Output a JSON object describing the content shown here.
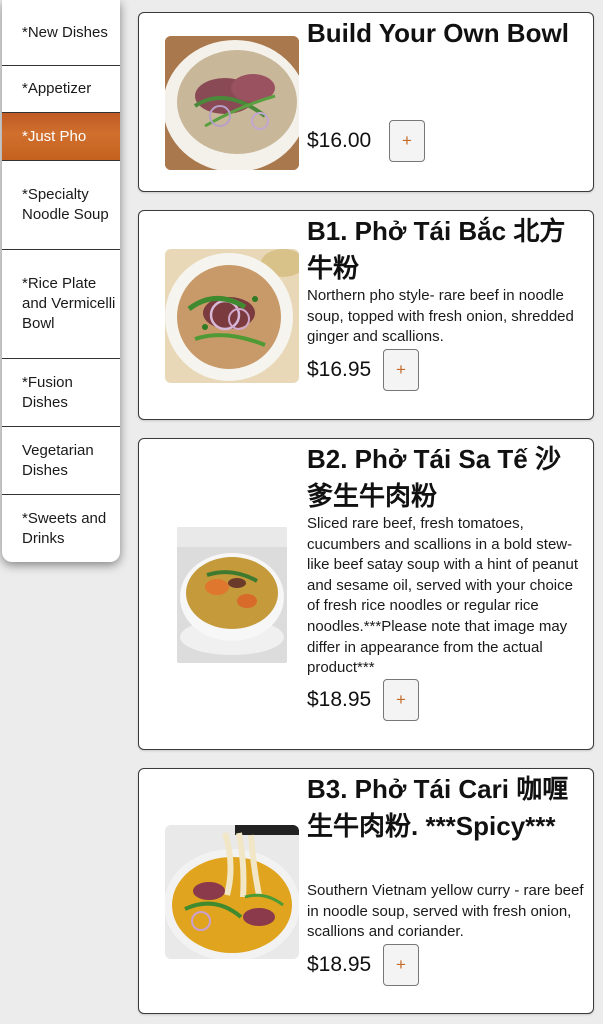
{
  "sidebar": {
    "items": [
      {
        "label": "*New Dishes"
      },
      {
        "label": "*Appetizer"
      },
      {
        "label": "*Just Pho"
      },
      {
        "label": "*Specialty Noodle Soup"
      },
      {
        "label": "*Rice Plate and Vermicelli Bowl"
      },
      {
        "label": "*Fusion Dishes"
      },
      {
        "label": "Vegetarian Dishes"
      },
      {
        "label": "*Sweets and Drinks"
      }
    ],
    "active_index": 2,
    "active_color": "#cc6a2c"
  },
  "menu": {
    "add_label": "+",
    "items": [
      {
        "name": "Build Your Own Bowl",
        "description": "",
        "price": "$16.00",
        "image": "pho-bowl-raw-beef"
      },
      {
        "name": "B1. Phở Tái Bắc 北方牛粉",
        "description": "Northern pho style- rare beef in noodle soup, topped with fresh onion, shredded ginger and scallions.",
        "price": "$16.95",
        "image": "pho-bowl-with-sprouts"
      },
      {
        "name": "B2. Phở Tái Sa Tế 沙爹生牛肉粉",
        "description": "Sliced rare beef, fresh tomatoes, cucumbers and scallions in a bold stew-like beef satay soup with a hint of peanut and sesame oil, served with your choice of fresh rice noodles or regular rice noodles.***Please note that image may differ in appearance from the actual product***",
        "price": "$18.95",
        "image": "satay-soup-bowl"
      },
      {
        "name": "B3. Phở Tái Cari 咖喱生牛肉粉. ***Spicy***",
        "description": "Southern Vietnam yellow curry - rare beef in noodle soup, served with fresh onion, scallions and coriander.",
        "price": "$18.95",
        "image": "curry-noodle-bowl"
      }
    ]
  }
}
